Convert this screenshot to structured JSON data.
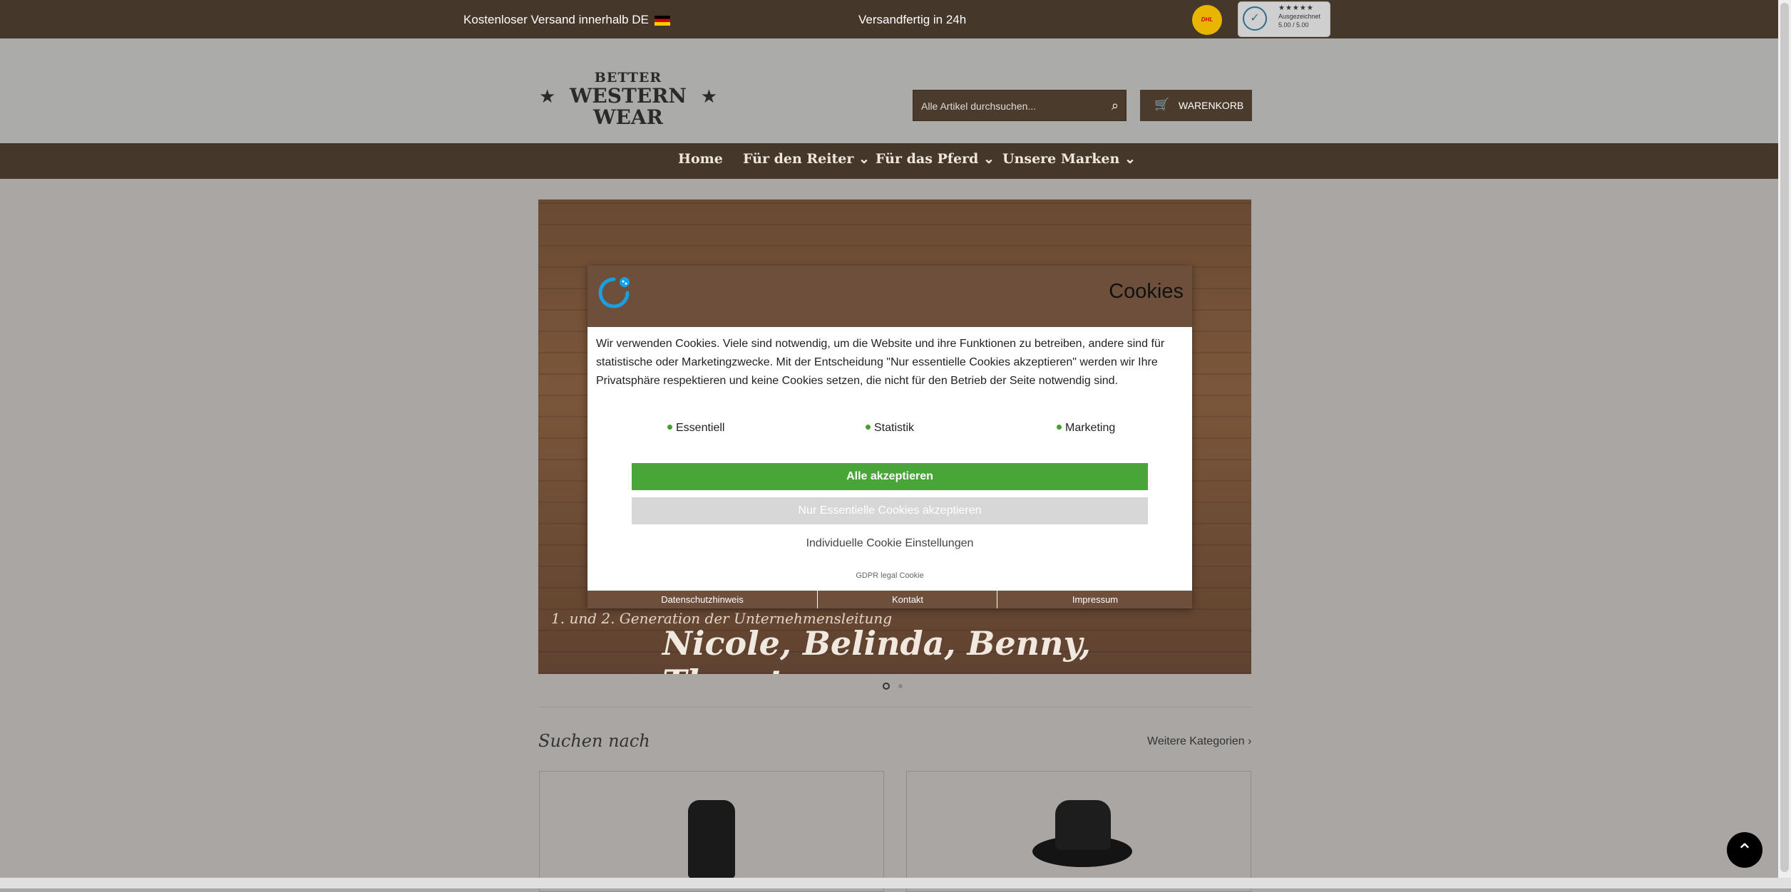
{
  "topbar": {
    "shipping_text": "Kostenloser Versand innerhalb DE",
    "ready_text": "Versandfertig in 24h",
    "dhl_label": "DHL",
    "badge": {
      "stars": "★★★★★",
      "label": "Ausgezeichnet",
      "score": "5.00 / 5.00"
    }
  },
  "header": {
    "logo_line1": "BETTER",
    "logo_line2": "WESTERN WEAR",
    "search_placeholder": "Alle Artikel durchsuchen...",
    "cart_label": "WARENKORB"
  },
  "nav": {
    "items": [
      "Home",
      "Für den Reiter",
      "Für das Pferd",
      "Unsere Marken"
    ]
  },
  "slide": {
    "caption_small": "1. und 2. Generation der Unternehmensleitung",
    "caption_large": "Nicole, Belinda, Benny, Thorsten",
    "active_index": 1,
    "total": 2
  },
  "section": {
    "title": "Suchen nach",
    "more_link": "Weitere Kategorien ›"
  },
  "cookie_modal": {
    "title": "Cookies",
    "text": "Wir verwenden Cookies. Viele sind notwendig, um die Website und ihre Funktionen zu betreiben, andere sind für statistische oder Marketingzwecke. Mit der Entscheidung \"Nur essentielle Cookies akzeptieren\" werden wir Ihre Privatsphäre respektieren und keine Cookies setzen, die nicht für den Betrieb der Seite notwendig sind.",
    "options": [
      "Essentiell",
      "Statistik",
      "Marketing"
    ],
    "accept_all": "Alle akzeptieren",
    "accept_essential": "Nur Essentielle Cookies akzeptieren",
    "individual": "Individuelle Cookie Einstellungen",
    "brand": "GDPR legal Cookie",
    "footer": [
      "Datenschutzhinweis",
      "Kontakt",
      "Impressum"
    ],
    "accent_color": "#47a637",
    "header_color": "#6e4f3b"
  },
  "colors": {
    "brand_brown": "#46372b"
  }
}
